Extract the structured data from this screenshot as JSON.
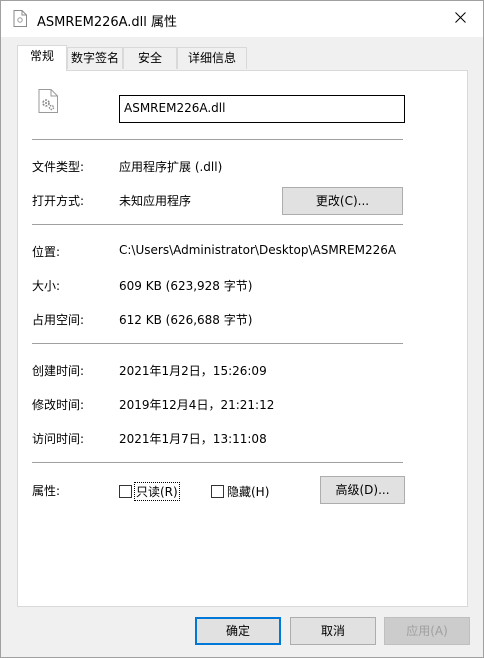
{
  "window": {
    "title": "ASMREM226A.dll 属性",
    "close_icon": "close-icon"
  },
  "tabs": [
    {
      "label": "常规",
      "active": true
    },
    {
      "label": "数字签名",
      "active": false
    },
    {
      "label": "安全",
      "active": false
    },
    {
      "label": "详细信息",
      "active": false
    }
  ],
  "general": {
    "file_icon": "dll-file-icon",
    "file_name": "ASMREM226A.dll",
    "type_label": "文件类型:",
    "type_value": "应用程序扩展 (.dll)",
    "open_label": "打开方式:",
    "open_value": "未知应用程序",
    "change_button": "更改(C)...",
    "location_label": "位置:",
    "location_value": "C:\\Users\\Administrator\\Desktop\\ASMREM226A",
    "size_label": "大小:",
    "size_value": "609 KB (623,928 字节)",
    "disk_label": "占用空间:",
    "disk_value": "612 KB (626,688 字节)",
    "created_label": "创建时间:",
    "created_value": "2021年1月2日，15:26:09",
    "modified_label": "修改时间:",
    "modified_value": "2019年12月4日，21:21:12",
    "accessed_label": "访问时间:",
    "accessed_value": "2021年1月7日，13:11:08",
    "attr_label": "属性:",
    "readonly_label": "只读(R)",
    "readonly_checked": false,
    "hidden_label": "隐藏(H)",
    "hidden_checked": false,
    "advanced_button": "高级(D)..."
  },
  "footer": {
    "ok_button": "确定",
    "cancel_button": "取消",
    "apply_button": "应用(A)"
  },
  "colors": {
    "accent": "#0078d7",
    "button_bg": "#e1e1e1",
    "panel_bg": "#ffffff",
    "window_bg": "#f0f0f0"
  }
}
